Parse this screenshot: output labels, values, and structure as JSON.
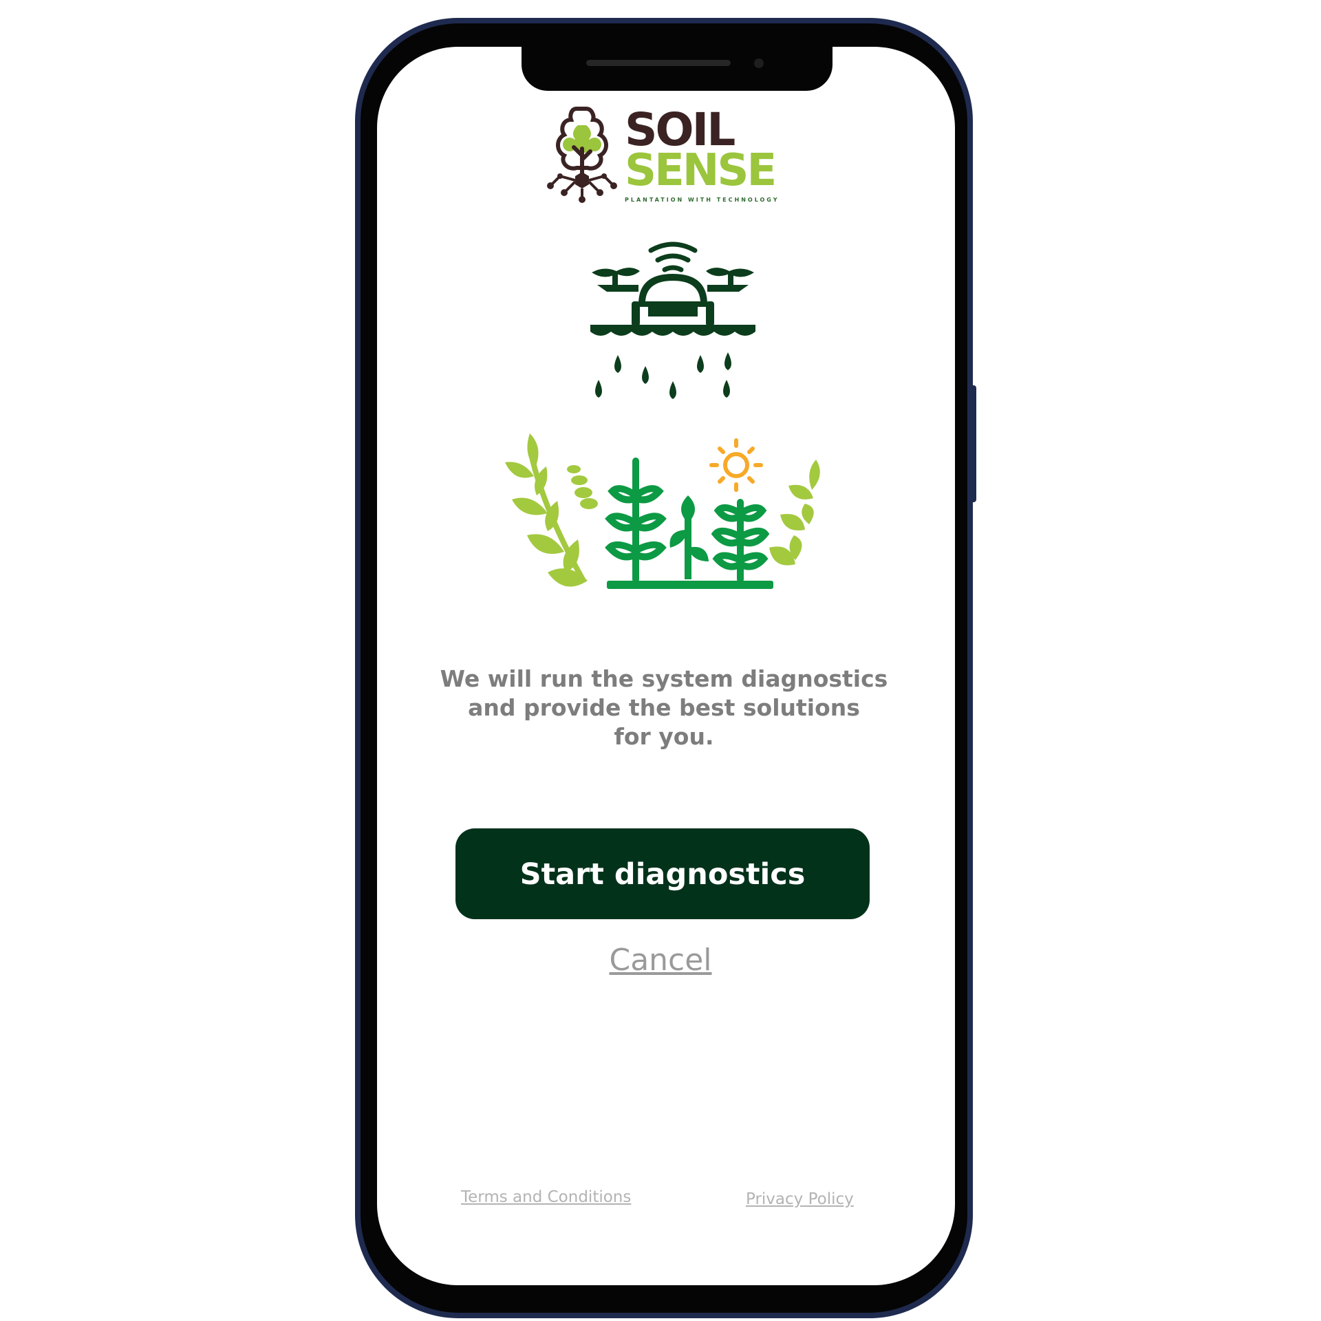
{
  "app": {
    "logo": {
      "line1": "SOIL",
      "line2": "SENSE",
      "tagline": "PLANTATION WITH TECHNOLOGY",
      "colors": {
        "soil": "#3b2323",
        "sense": "#9bc53d"
      }
    }
  },
  "illustrations": {
    "drone": "drone-watering-icon",
    "plants": "plants-with-sun-icon"
  },
  "main": {
    "message": "We will run the system diagnostics\nand provide the best solutions\nfor you.",
    "start_button_label": "Start diagnostics",
    "cancel_label": "Cancel"
  },
  "footer": {
    "terms_label": "Terms and Conditions",
    "privacy_label": "Privacy Policy"
  },
  "colors": {
    "primary_button": "#03321b",
    "phone_frame": "#1f2a4f",
    "dark_green": "#0c3d1c",
    "light_green": "#a3c93f",
    "mid_green": "#0c9a44",
    "sun": "#f7a928",
    "muted_text": "#7d7d7d"
  }
}
